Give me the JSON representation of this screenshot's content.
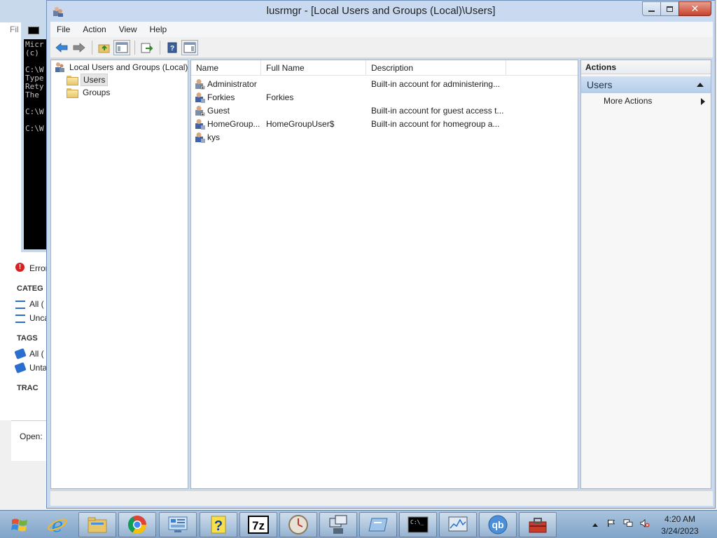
{
  "background_app": {
    "menu_label": "Fil",
    "side_items": [
      "Error",
      "All (",
      "Unca",
      "All (",
      "Unta"
    ],
    "categories_header": "CATEG",
    "tags_header": "TAGS",
    "trackers_header": "TRAC",
    "open_label": "Open:"
  },
  "console": {
    "lines": "Micr\n(c)\n\nC:\\W\nType\nRety\nThe\n\nC:\\W\n\nC:\\W"
  },
  "window": {
    "title": "lusrmgr - [Local Users and Groups (Local)\\Users]",
    "minimize_icon": "minimize-icon",
    "maximize_icon": "restore-icon",
    "close_glyph": "✕"
  },
  "menu": {
    "file": "File",
    "action": "Action",
    "view": "View",
    "help": "Help"
  },
  "tree": {
    "root": "Local Users and Groups (Local)",
    "users": "Users",
    "groups": "Groups"
  },
  "list": {
    "columns": {
      "name": "Name",
      "full_name": "Full Name",
      "description": "Description"
    },
    "rows": [
      {
        "name": "Administrator",
        "full_name": "",
        "description": "Built-in account for administering..."
      },
      {
        "name": "Forkies",
        "full_name": "Forkies",
        "description": ""
      },
      {
        "name": "Guest",
        "full_name": "",
        "description": "Built-in account for guest access t..."
      },
      {
        "name": "HomeGroup...",
        "full_name": "HomeGroupUser$",
        "description": "Built-in account for homegroup a..."
      },
      {
        "name": "kys",
        "full_name": "",
        "description": ""
      }
    ]
  },
  "actions_pane": {
    "header": "Actions",
    "section": "Users",
    "more_actions": "More Actions"
  },
  "taskbar": {
    "time": "4:20 AM",
    "date": "3/24/2023",
    "apps": [
      "internet-explorer-icon",
      "file-explorer-icon",
      "chrome-icon",
      "control-panel-icon",
      "help-icon",
      "7zip-icon",
      "clock-icon",
      "network-computer-icon",
      "remote-desktop-icon",
      "cmd-icon",
      "performance-monitor-icon",
      "qbittorrent-icon",
      "toolbox-icon"
    ]
  },
  "colors": {
    "window_frame": "#c9daf0",
    "close_button": "#c7412d",
    "actions_section": "#b6cde8",
    "taskbar": "#7fa3c8"
  }
}
